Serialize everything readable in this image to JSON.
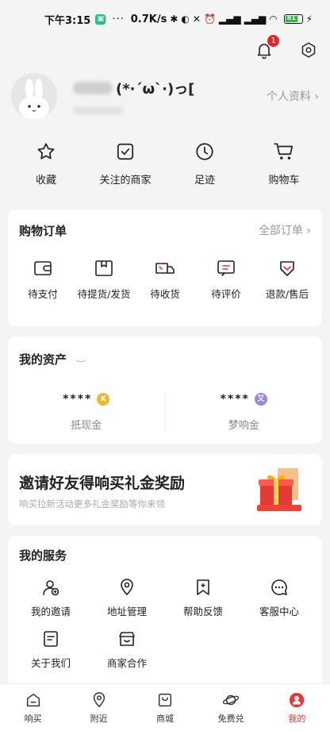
{
  "status_bar": {
    "time": "下午3:15",
    "dots": "···",
    "speed": "0.7K/s",
    "battery": "81"
  },
  "header": {
    "notification_count": "1"
  },
  "profile": {
    "nickname_suffix": "(*·´ω`·)っ[",
    "profile_link": "个人资料 ›"
  },
  "quick": [
    {
      "label": "收藏",
      "icon": "star-icon"
    },
    {
      "label": "关注的商家",
      "icon": "checkbox-icon"
    },
    {
      "label": "足迹",
      "icon": "clock-icon"
    },
    {
      "label": "购物车",
      "icon": "cart-icon"
    }
  ],
  "orders": {
    "title": "购物订单",
    "all_label": "全部订单 ›",
    "items": [
      {
        "label": "待支付",
        "icon": "wallet-icon"
      },
      {
        "label": "待提货/发货",
        "icon": "box-icon"
      },
      {
        "label": "待收货",
        "icon": "truck-icon"
      },
      {
        "label": "待评价",
        "icon": "comment-icon"
      },
      {
        "label": "退款/售后",
        "icon": "refund-icon"
      }
    ]
  },
  "assets": {
    "title": "我的资产",
    "items": [
      {
        "value": "****",
        "coin": "K",
        "label": "抵现金",
        "color": "#f4b62b"
      },
      {
        "value": "****",
        "coin": "又",
        "label": "梦响金",
        "color": "#9a86e0"
      }
    ]
  },
  "invite": {
    "title": "邀请好友得响买礼金奖励",
    "subtitle": "响买拉新活动更多礼金奖励等你来领"
  },
  "services": {
    "title": "我的服务",
    "items": [
      {
        "label": "我的邀请",
        "icon": "user-add-icon"
      },
      {
        "label": "地址管理",
        "icon": "location-icon"
      },
      {
        "label": "帮助反馈",
        "icon": "bookmark-icon"
      },
      {
        "label": "客服中心",
        "icon": "chat-icon"
      },
      {
        "label": "关于我们",
        "icon": "document-icon"
      },
      {
        "label": "商家合作",
        "icon": "store-icon"
      }
    ]
  },
  "tabs": [
    {
      "label": "响买",
      "icon": "home-icon"
    },
    {
      "label": "附近",
      "icon": "location-icon"
    },
    {
      "label": "商城",
      "icon": "bag-icon"
    },
    {
      "label": "免费兑",
      "icon": "planet-icon"
    },
    {
      "label": "我的",
      "icon": "profile-icon",
      "active": true
    }
  ],
  "colors": {
    "accent": "#e53935",
    "badge": "#e22222"
  }
}
